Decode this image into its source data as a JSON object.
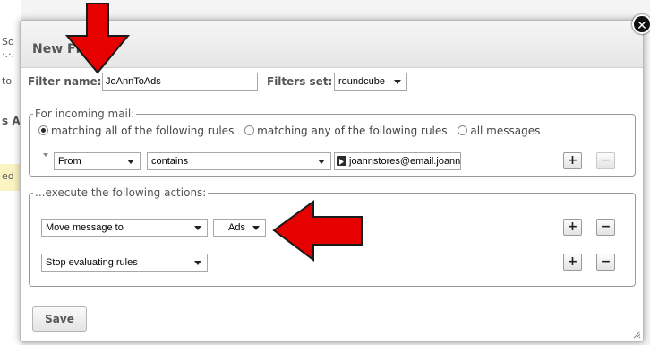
{
  "background": {
    "fragments": [
      "So",
      "·.·.",
      "to",
      "s A",
      "ed"
    ]
  },
  "dialog": {
    "title": "New Filter",
    "close_glyph": "✕"
  },
  "filter_form": {
    "name_label": "Filter name:",
    "name_value": "JoAnnToAds",
    "set_label": "Filters set:",
    "set_value": "roundcube"
  },
  "incoming": {
    "legend": "For incoming mail:",
    "options": [
      {
        "label": "matching all of the following rules",
        "selected": true
      },
      {
        "label": "matching any of the following rules",
        "selected": false
      },
      {
        "label": "all messages",
        "selected": false
      }
    ],
    "rule": {
      "header": "From",
      "operator": "contains",
      "value": "joannstores@email.joann"
    }
  },
  "actions": {
    "legend": "...execute the following actions:",
    "items": [
      {
        "action": "Move message to",
        "target": "Ads"
      },
      {
        "action": "Stop evaluating rules"
      }
    ]
  },
  "buttons": {
    "add": "+",
    "remove": "−",
    "save": "Save"
  },
  "colors": {
    "arrow_fill": "#e60000",
    "arrow_stroke": "#1a1a1a"
  }
}
